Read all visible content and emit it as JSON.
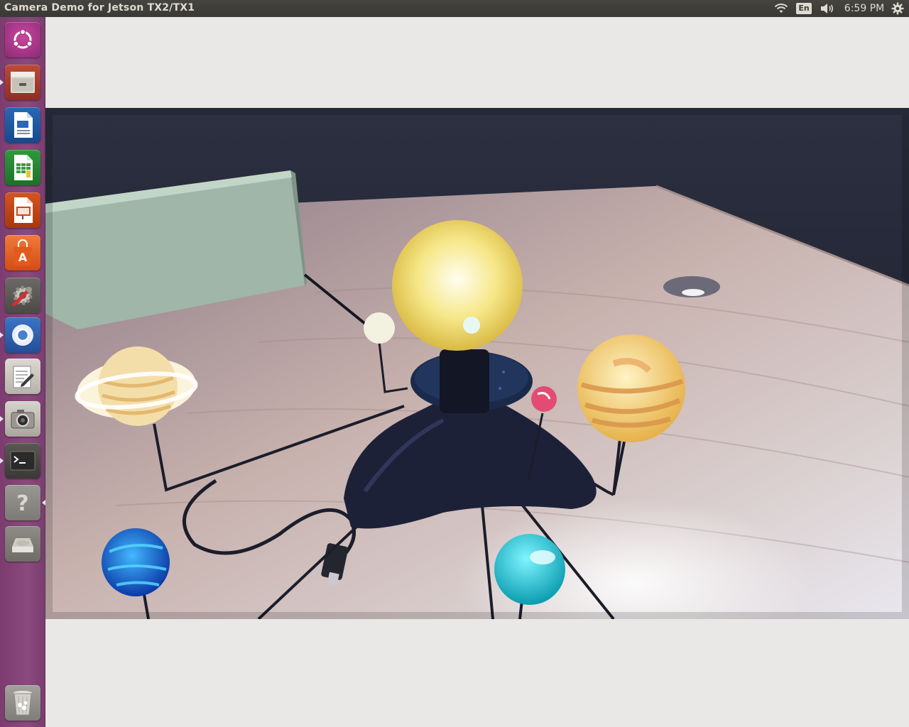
{
  "window": {
    "title": "Camera Demo for Jetson TX2/TX1"
  },
  "panel": {
    "language": "En",
    "clock": "6:59 PM",
    "indicators": [
      "wifi-icon",
      "keyboard-language-indicator",
      "sound-icon",
      "gear-icon"
    ]
  },
  "launcher": {
    "items": [
      {
        "name": "dash-home",
        "icon": "ubuntu-logo-icon"
      },
      {
        "name": "files",
        "icon": "file-cabinet-icon"
      },
      {
        "name": "libreoffice-writer",
        "icon": "document-icon"
      },
      {
        "name": "libreoffice-calc",
        "icon": "spreadsheet-icon"
      },
      {
        "name": "libreoffice-impress",
        "icon": "presentation-icon"
      },
      {
        "name": "ubuntu-software",
        "icon": "shopping-bag-icon"
      },
      {
        "name": "system-settings",
        "icon": "gear-wrench-icon"
      },
      {
        "name": "chromium",
        "icon": "browser-icon"
      },
      {
        "name": "text-editor",
        "icon": "notepad-pencil-icon"
      },
      {
        "name": "camera-demo",
        "icon": "camera-icon"
      },
      {
        "name": "terminal",
        "icon": "terminal-icon"
      },
      {
        "name": "help",
        "icon": "question-mark-icon"
      },
      {
        "name": "disk",
        "icon": "hard-drive-icon"
      },
      {
        "name": "trash",
        "icon": "trash-icon"
      }
    ],
    "colors": {
      "background": "#7c3c70",
      "accent": "#e1501f"
    }
  },
  "camera": {
    "scene": "solar-system-model-on-desk",
    "colors": {
      "desk": "#c9b3b2",
      "wall": "#1f2233",
      "sun": "#f7e27a"
    }
  }
}
